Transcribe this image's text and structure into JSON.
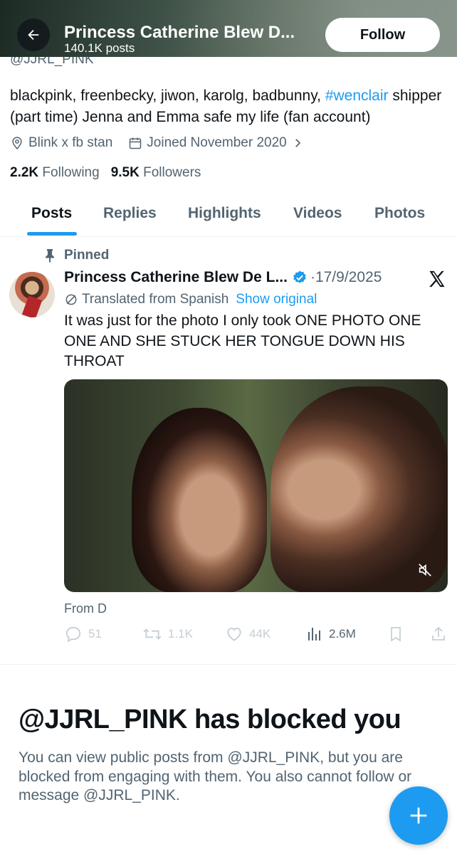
{
  "header": {
    "display_name": "Princess Catherine Blew D...",
    "post_count": "140.1K posts",
    "follow_label": "Follow",
    "handle": "@JJRL_PINK"
  },
  "profile": {
    "bio_text": "blackpink, freenbecky, jiwon, karolg, badbunny, ",
    "bio_hashtag": "#wenclair",
    "bio_text_2": " shipper (part time) Jenna and Emma safe my life (fan account)",
    "location": "Blink x fb stan",
    "joined": "Joined November 2020",
    "following_count": "2.2K",
    "following_label": "Following",
    "followers_count": "9.5K",
    "followers_label": "Followers"
  },
  "tabs": [
    "Posts",
    "Replies",
    "Highlights",
    "Videos",
    "Photos"
  ],
  "post": {
    "pinned_label": "Pinned",
    "author_name": "Princess Catherine Blew De L...",
    "date": "·17/9/2025",
    "translated_label": "Translated from Spanish",
    "show_original": "Show original",
    "text": "It was just for the photo I only took ONE PHOTO  ONE ONE  AND SHE STUCK HER TONGUE DOWN HIS THROAT",
    "source_caption": "From D",
    "replies": "51",
    "reposts": "1.1K",
    "likes": "44K",
    "views": "2.6M"
  },
  "blocked": {
    "title": "@JJRL_PINK has blocked you",
    "message": "You can view public posts from @JJRL_PINK, but you are blocked from engaging with them. You also cannot follow or message @JJRL_PINK."
  },
  "colors": {
    "accent": "#1d9bf0",
    "secondary_text": "#536471",
    "primary_text": "#0f1419"
  },
  "icons": [
    "back-arrow-icon",
    "location-icon",
    "calendar-icon",
    "chevron-right-icon",
    "pin-icon",
    "verified-badge-icon",
    "x-logo-icon",
    "translate-icon",
    "mute-icon",
    "reply-icon",
    "repost-icon",
    "like-icon",
    "views-icon",
    "bookmark-icon",
    "share-icon",
    "compose-plus-icon"
  ]
}
